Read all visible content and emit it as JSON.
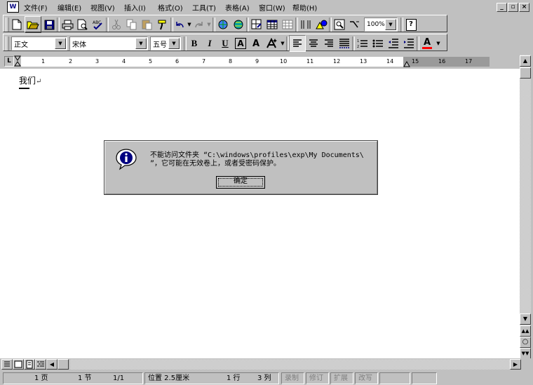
{
  "menu": {
    "app_icon": "W",
    "items": [
      "文件(F)",
      "编辑(E)",
      "视图(V)",
      "插入(I)",
      "格式(O)",
      "工具(T)",
      "表格(A)",
      "窗口(W)",
      "帮助(H)"
    ],
    "window_buttons": [
      "_",
      "▫",
      "×"
    ]
  },
  "format": {
    "style": "正文",
    "font": "宋体",
    "size": "五号",
    "bold": "B",
    "italic": "I",
    "underline": "U",
    "char_border": "A",
    "char_shading": "A",
    "font_color": "A"
  },
  "standard": {
    "zoom": "100%",
    "help": "?"
  },
  "ruler": {
    "numbers": [
      "1",
      "2",
      "3",
      "4",
      "5",
      "6",
      "7",
      "8",
      "9",
      "10",
      "11",
      "12",
      "13",
      "14",
      "15",
      "16",
      "17"
    ],
    "corner": "L"
  },
  "document": {
    "text": "我们",
    "paragraph_mark": "↵"
  },
  "dialog": {
    "message_line1": "不能访问文件夹 “C:\\windows\\profiles\\exp\\My Documents\\",
    "message_line2": "”，它可能在无效卷上，或者受密码保护。",
    "ok_label": "确定",
    "icon": "info-icon"
  },
  "statusbar": {
    "page": "1 页",
    "section": "1 节",
    "page_of": "1/1",
    "position": "位置 2.5厘米",
    "line": "1 行",
    "column": "3 列",
    "rec": "录制",
    "trk": "修订",
    "ext": "扩展",
    "ovr": "改写"
  },
  "colors": {
    "face": "#c0c0c0",
    "shadow": "#808080",
    "dialog_icon": "#000080",
    "font_color_bar": "#ff0000"
  }
}
